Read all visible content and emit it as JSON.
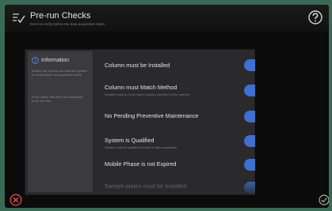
{
  "header": {
    "title": "Pre-run Checks",
    "subtitle": "Items to verify before the data acquisition starts",
    "help_icon": "question-circle-icon",
    "title_icon": "checklist-icon"
  },
  "info": {
    "title": "Information",
    "text": "Enable the checks you want the system to verify before an acquisition starts.",
    "text2": "If any check fails then the acquisition does not start."
  },
  "checks": [
    {
      "label": "Column must be Installed",
      "desc": "",
      "enabled": true
    },
    {
      "label": "Column must Match Method",
      "desc": "Installed column must match column specified in the method",
      "enabled": true
    },
    {
      "label": "No Pending Preventive Maintenance",
      "desc": "",
      "enabled": true
    },
    {
      "label": "System is Qualified",
      "desc": "System must be qualified at start of data acquisition",
      "enabled": true
    },
    {
      "label": "Mobile Phase is not Expired",
      "desc": "",
      "enabled": true
    },
    {
      "label": "Sample plates must be Installed",
      "desc": "",
      "enabled": true
    }
  ],
  "footer": {
    "cancel_icon": "close-circle-icon",
    "confirm_icon": "check-circle-icon"
  },
  "colors": {
    "accent": "#3f6fd0",
    "cancel": "#e14b4b",
    "confirm": "#a8b0a4"
  }
}
